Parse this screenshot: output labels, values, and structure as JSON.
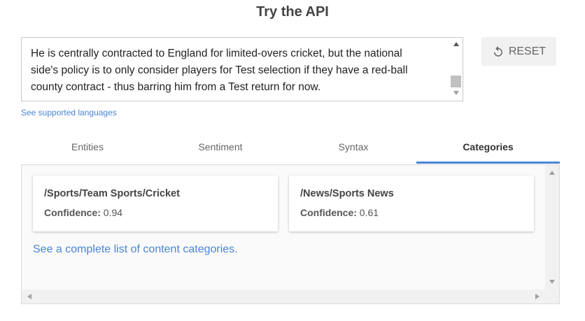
{
  "header": {
    "title": "Try the API"
  },
  "input": {
    "text": "He is centrally contracted to England for limited-overs cricket, but the national side's policy is to only consider players for Test selection if they have a red-ball county contract - thus barring him from a Test return for now."
  },
  "reset_button": {
    "label": "RESET",
    "icon": "reset-icon"
  },
  "supported_languages_link": "See supported languages",
  "tabs": [
    {
      "label": "Entities"
    },
    {
      "label": "Sentiment"
    },
    {
      "label": "Syntax"
    },
    {
      "label": "Categories",
      "active": true
    }
  ],
  "categories": [
    {
      "name": "/Sports/Team Sports/Cricket",
      "confidence_label": "Confidence:",
      "confidence": "0.94"
    },
    {
      "name": "/News/Sports News",
      "confidence_label": "Confidence:",
      "confidence": "0.61"
    }
  ],
  "categories_link": "See a complete list of content categories.",
  "colors": {
    "accent": "#4a85d4",
    "tab_underline": "#4a85d4"
  }
}
